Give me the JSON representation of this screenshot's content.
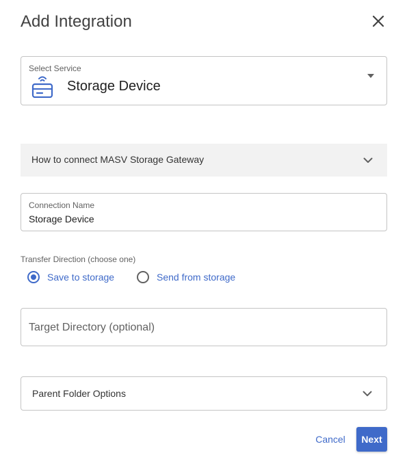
{
  "dialog": {
    "title": "Add Integration",
    "close_icon": "close-icon"
  },
  "service": {
    "label": "Select Service",
    "value": "Storage Device",
    "icon": "storage-device-icon"
  },
  "accordion_connect": {
    "label": "How to connect MASV Storage Gateway",
    "icon": "chevron-down-icon"
  },
  "connection": {
    "label": "Connection Name",
    "value": "Storage Device"
  },
  "transfer_direction": {
    "label": "Transfer Direction (choose one)",
    "options": [
      {
        "label": "Save to storage",
        "selected": true
      },
      {
        "label": "Send from storage",
        "selected": false
      }
    ]
  },
  "target_directory": {
    "placeholder": "Target Directory (optional)"
  },
  "accordion_parent": {
    "label": "Parent Folder Options",
    "icon": "chevron-down-icon"
  },
  "actions": {
    "cancel_label": "Cancel",
    "next_label": "Next"
  },
  "colors": {
    "accent": "#3f6ac9",
    "accordion_bg": "#f2f2f2",
    "border": "#c4c4c4"
  }
}
